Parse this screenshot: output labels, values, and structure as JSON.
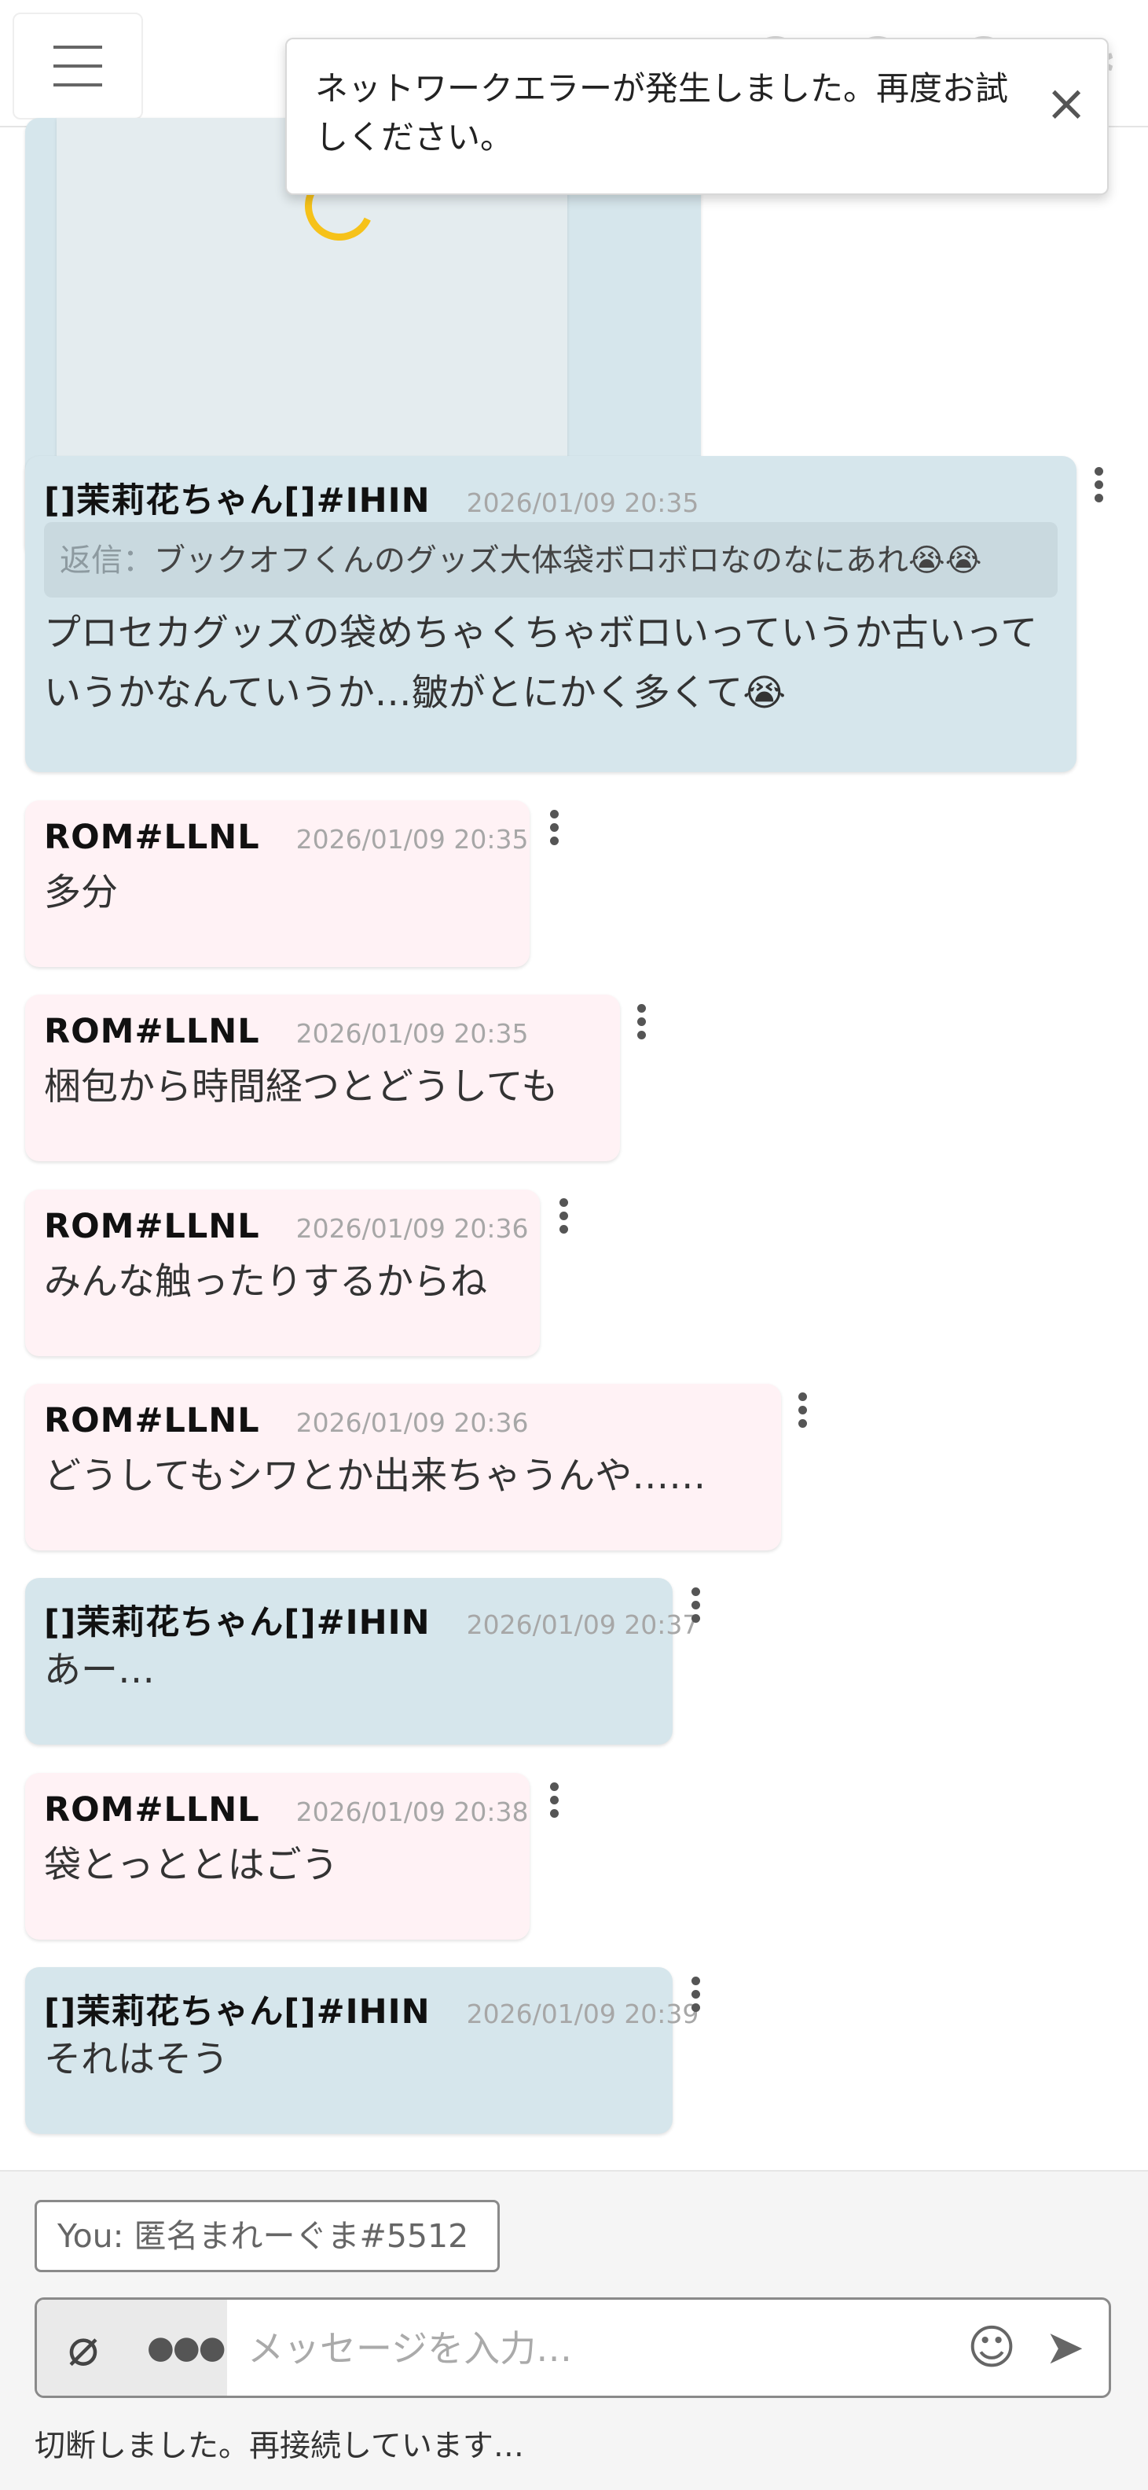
{
  "header": {
    "menu_icon": "hamburger-menu-icon",
    "settings_icon": "gear-icon"
  },
  "toast": {
    "message": "ネットワークエラーが発生しました。再度お試しください。",
    "close_icon": "close-icon"
  },
  "messages": [
    {
      "author": "[]茉莉花ちゃん[]#IHIN",
      "timestamp": "2026/01/09 20:35",
      "reply_label": "返信：",
      "reply_text": "ブックオフくんのグッズ大体袋ボロボロなのなにあれ😭😭",
      "text": "プロセカグッズの袋めちゃくちゃボロいっていうか古いっていうかなんていうか…皺がとにかく多くて😭",
      "color": "blue"
    },
    {
      "author": "ROM#LLNL",
      "timestamp": "2026/01/09 20:35",
      "text": "多分",
      "color": "pink"
    },
    {
      "author": "ROM#LLNL",
      "timestamp": "2026/01/09 20:35",
      "text": "梱包から時間経つとどうしても",
      "color": "pink"
    },
    {
      "author": "ROM#LLNL",
      "timestamp": "2026/01/09 20:36",
      "text": "みんな触ったりするからね",
      "color": "pink"
    },
    {
      "author": "ROM#LLNL",
      "timestamp": "2026/01/09 20:36",
      "text": "どうしてもシワとか出来ちゃうんや……",
      "color": "pink"
    },
    {
      "author": "[]茉莉花ちゃん[]#IHIN",
      "timestamp": "2026/01/09 20:37",
      "text": "あー…",
      "color": "blue"
    },
    {
      "author": "ROM#LLNL",
      "timestamp": "2026/01/09 20:38",
      "text": "袋とっととはごう",
      "color": "pink"
    },
    {
      "author": "[]茉莉花ちゃん[]#IHIN",
      "timestamp": "2026/01/09 20:39",
      "text": "それはそう",
      "color": "blue"
    }
  ],
  "composer": {
    "you_label": "You: 匿名まれーぐま#5512",
    "placeholder": "メッセージを入力…",
    "attach_icon": "paperclip-icon",
    "more_icon": "more-dots-icon",
    "emoji_icon": "smiley-icon",
    "send_icon": "send-icon"
  },
  "connection_status": "切断しました。再接続しています…",
  "colors": {
    "own_bubble": "#d6e6ec",
    "other_bubble": "#fff2f5",
    "spinner": "#f6c21a"
  }
}
